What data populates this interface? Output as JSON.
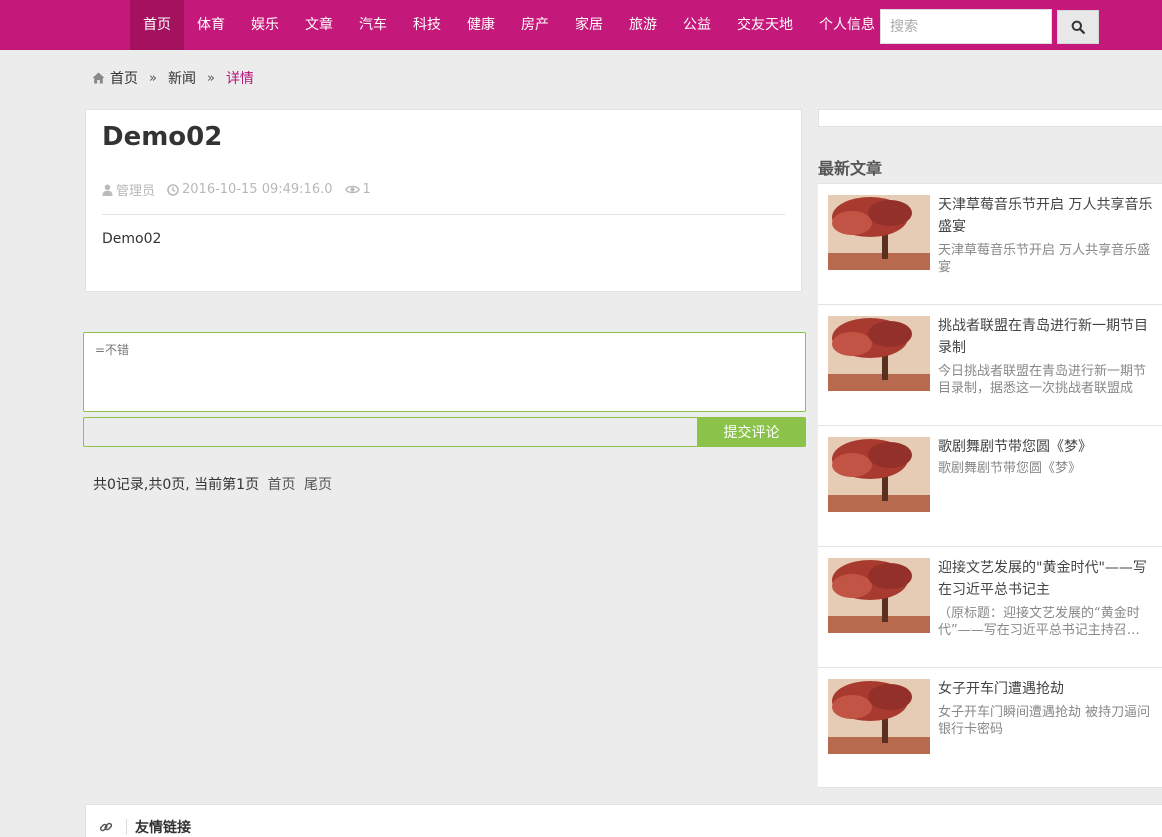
{
  "nav": {
    "items": [
      {
        "label": "首页",
        "active": true
      },
      {
        "label": "体育"
      },
      {
        "label": "娱乐"
      },
      {
        "label": "文章"
      },
      {
        "label": "汽车"
      },
      {
        "label": "科技"
      },
      {
        "label": "健康"
      },
      {
        "label": "房产"
      },
      {
        "label": "家居"
      },
      {
        "label": "旅游"
      },
      {
        "label": "公益"
      },
      {
        "label": "交友天地"
      },
      {
        "label": "个人信息"
      }
    ],
    "search_placeholder": "搜索",
    "search_icon": "search-icon"
  },
  "breadcrumb": {
    "home": "首页",
    "section": "新闻",
    "current": "详情",
    "sep": "»"
  },
  "article": {
    "title": "Demo02",
    "author": "管理员",
    "date": "2016-10-15 09:49:16.0",
    "views": "1",
    "body": "Demo02"
  },
  "comment": {
    "text": "=不错",
    "submit_label": "提交评论"
  },
  "pagination": {
    "summary": "共0记录,共0页, 当前第1页",
    "first": "首页",
    "last": "尾页"
  },
  "sidebar": {
    "heading": "最新文章",
    "news": [
      {
        "title": "天津草莓音乐节开启 万人共享音乐盛宴",
        "summary": "天津草莓音乐节开启 万人共享音乐盛宴"
      },
      {
        "title": "挑战者联盟在青岛进行新一期节目录制",
        "summary": "今日挑战者联盟在青岛进行新一期节目录制，据悉这一次挑战者联盟成员…"
      },
      {
        "title": "歌剧舞剧节带您圆《梦》",
        "summary": "歌剧舞剧节带您圆《梦》"
      },
      {
        "title": "迎接文艺发展的\"黄金时代\"——写在习近平总书记主",
        "summary": "（原标题：迎接文艺发展的“黄金时代”——写在习近平总书记主持召…"
      },
      {
        "title": "女子开车门遭遇抢劫",
        "summary": "女子开车门瞬间遭遇抢劫 被持刀逼问银行卡密码"
      }
    ]
  },
  "footer": {
    "friend_links_title": "友情链接"
  },
  "colors": {
    "brand": "#c4197a",
    "accent_green": "#8bc34a"
  }
}
